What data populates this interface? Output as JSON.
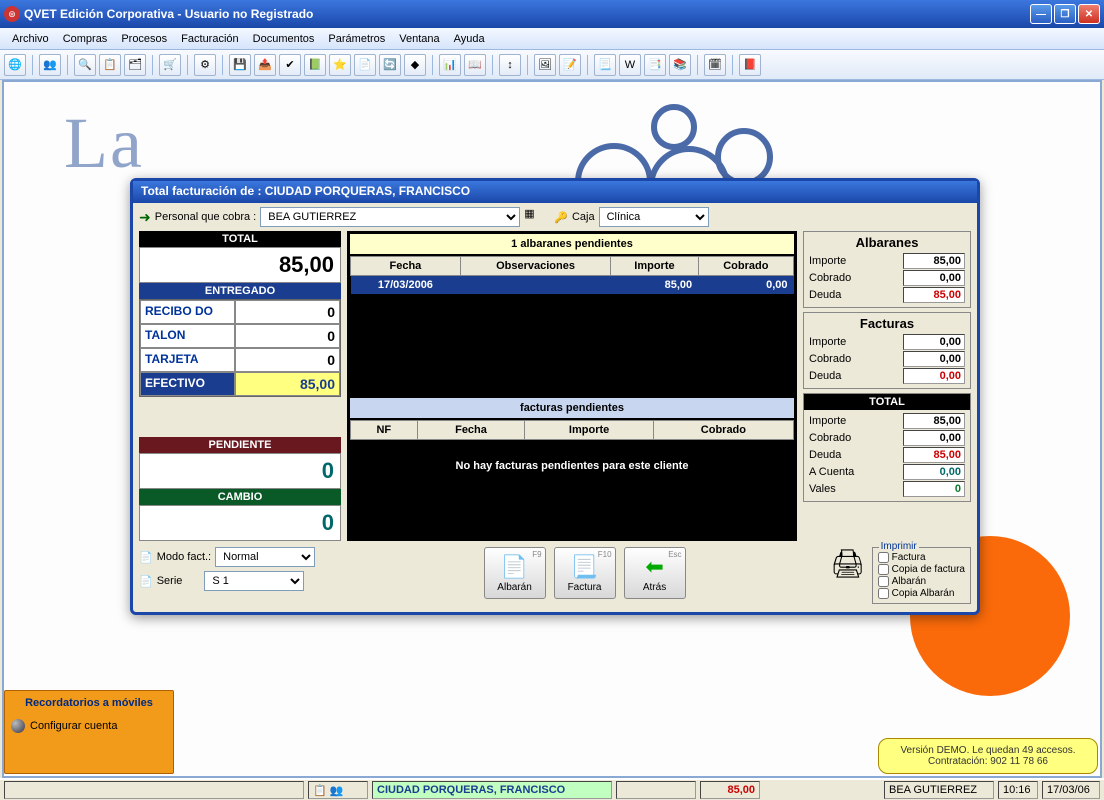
{
  "window": {
    "title": "QVET Edición Corporativa - Usuario no Registrado"
  },
  "menu": [
    "Archivo",
    "Compras",
    "Procesos",
    "Facturación",
    "Documentos",
    "Parámetros",
    "Ventana",
    "Ayuda"
  ],
  "dialog": {
    "title": "Total facturación de : CIUDAD PORQUERAS, FRANCISCO",
    "personal_label": "Personal que cobra :",
    "personal_value": "BEA GUTIERREZ",
    "caja_label": "Caja",
    "caja_value": "Clínica",
    "total_label": "TOTAL",
    "total_value": "85,00",
    "entregado_label": "ENTREGADO",
    "payments": [
      {
        "label": "RECIBO DO",
        "value": "0"
      },
      {
        "label": "TALON",
        "value": "0"
      },
      {
        "label": "TARJETA",
        "value": "0"
      },
      {
        "label": "EFECTIVO",
        "value": "85,00",
        "active": true
      }
    ],
    "pendiente_label": "PENDIENTE",
    "pendiente_value": "0",
    "cambio_label": "CAMBIO",
    "cambio_value": "0",
    "albaranes": {
      "title": "1 albaranes pendientes",
      "cols": [
        "Fecha",
        "Observaciones",
        "Importe",
        "Cobrado"
      ],
      "rows": [
        {
          "fecha": "17/03/2006",
          "obs": "",
          "importe": "85,00",
          "cobrado": "0,00"
        }
      ]
    },
    "facturas": {
      "title": "facturas pendientes",
      "cols": [
        "NF",
        "Fecha",
        "Importe",
        "Cobrado"
      ],
      "empty": "No hay facturas pendientes para este cliente"
    },
    "summary_albaranes": {
      "title": "Albaranes",
      "importe": "85,00",
      "cobrado": "0,00",
      "deuda": "85,00"
    },
    "summary_facturas": {
      "title": "Facturas",
      "importe": "0,00",
      "cobrado": "0,00",
      "deuda": "0,00"
    },
    "summary_total": {
      "title": "TOTAL",
      "importe": "85,00",
      "cobrado": "0,00",
      "deuda": "85,00",
      "acuenta": "0,00",
      "vales": "0"
    },
    "labels": {
      "importe": "Importe",
      "cobrado": "Cobrado",
      "deuda": "Deuda",
      "acuenta": "A Cuenta",
      "vales": "Vales"
    },
    "modo_label": "Modo fact.:",
    "modo_value": "Normal",
    "serie_label": "Serie",
    "serie_value": "S 1",
    "buttons": {
      "albaran": "Albarán",
      "factura": "Factura",
      "atras": "Atrás"
    },
    "keys": {
      "albaran": "F9",
      "factura": "F10",
      "atras": "Esc"
    },
    "print": {
      "legend": "Imprimir",
      "opts": [
        "Factura",
        "Copia de factura",
        "Albarán",
        "Copia Albarán"
      ]
    }
  },
  "notif": {
    "title": "Recordatorios a móviles",
    "action": "Configurar cuenta"
  },
  "demo": "Versión DEMO. Le quedan 49 accesos. Contratación: 902 11 78 66",
  "status": {
    "client": "CIUDAD PORQUERAS, FRANCISCO",
    "amount": "85,00",
    "user": "BEA GUTIERREZ",
    "time": "10:16",
    "date": "17/03/06"
  },
  "bg_brand": "La"
}
